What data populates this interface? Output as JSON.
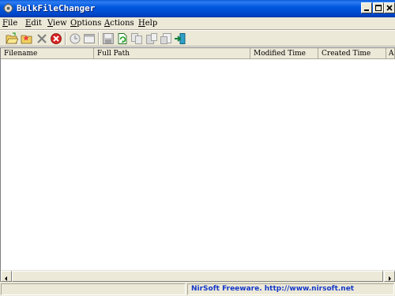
{
  "window": {
    "title": "BulkFileChanger",
    "icon": "app-gear-icon"
  },
  "title_buttons": [
    {
      "name": "minimize",
      "icon": "minimize-icon"
    },
    {
      "name": "maximize",
      "icon": "maximize-icon"
    },
    {
      "name": "close",
      "icon": "close-icon"
    }
  ],
  "menu": {
    "file": {
      "label": "File",
      "accel": "F",
      "rest": "ile"
    },
    "edit": {
      "label": "Edit",
      "accel": "E",
      "rest": "dit"
    },
    "view": {
      "label": "View",
      "accel": "V",
      "rest": "iew"
    },
    "options": {
      "label": "Options",
      "accel": "O",
      "rest": "ptions"
    },
    "actions": {
      "label": "Actions",
      "accel": "A",
      "rest": "ctions"
    },
    "help": {
      "label": "Help",
      "accel": "H",
      "rest": "elp"
    }
  },
  "toolbar_icons": [
    "open-folder-icon",
    "add-folder-icon",
    "delete-icon",
    "stop-icon",
    "clock-icon",
    "window-icon",
    "save-icon",
    "refresh-file-icon",
    "copy-icon",
    "paste-icon",
    "properties-icon",
    "exit-icon"
  ],
  "columns": {
    "filename": "Filename",
    "full_path": "Full Path",
    "modified_time": "Modified Time",
    "created_time": "Created Time",
    "accessed": "A"
  },
  "status": {
    "left_text": "",
    "link_text": "NirSoft Freeware.  http://www.nirsoft.net"
  },
  "colors": {
    "titlebar": "#0058e0",
    "close_button": "#e04020",
    "status_link": "#1438c8"
  }
}
